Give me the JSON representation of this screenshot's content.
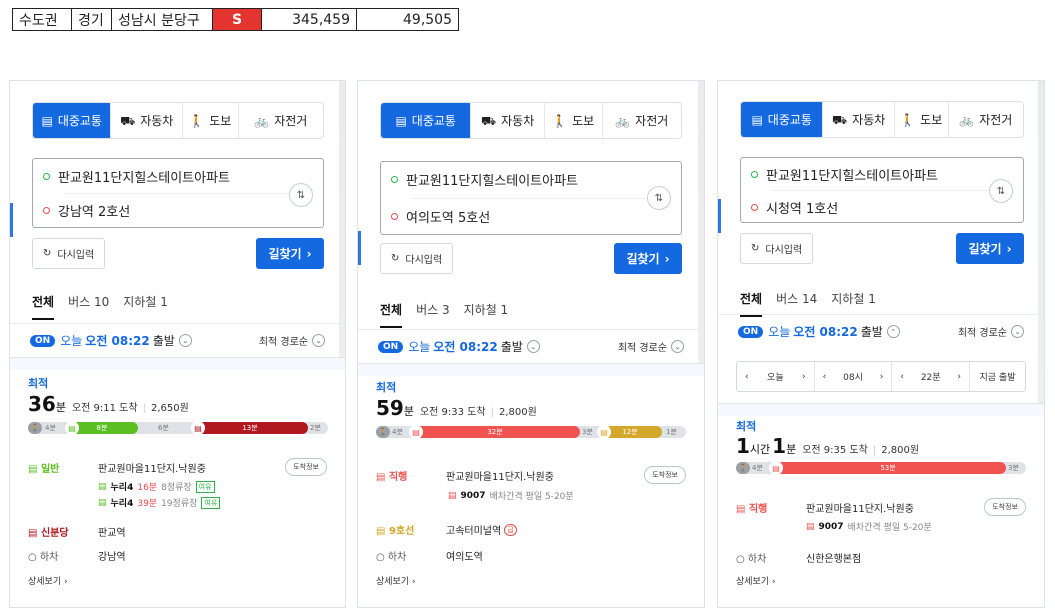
{
  "top_table": {
    "region": "수도권",
    "province": "경기",
    "city": "성남시 분당구",
    "grade": "S",
    "value1": "345,459",
    "value2": "49,505"
  },
  "mode_tabs": [
    "대중교통",
    "자동차",
    "도보",
    "자전거"
  ],
  "common": {
    "origin": "판교원11단지힐스테이트아파트",
    "reset_label": "다시입력",
    "find_label": "길찾기",
    "tab_all": "전체",
    "today": "오늘",
    "depart_time": "오전 08:22",
    "depart_suffix": "출발",
    "sort_label": "최적 경로순",
    "best_label": "최적",
    "arrive_info": "도착정보",
    "detail_link": "상세보기",
    "on_badge": "ON"
  },
  "panels": [
    {
      "destination": "강남역 2호선",
      "tab_bus": "버스 10",
      "tab_subway": "지하철 1",
      "summary": {
        "big": "36",
        "unit": "분",
        "arrive": "오전 9:11 도착",
        "fare": "2,650원"
      },
      "timeline": {
        "walk1": "4분",
        "seg1": "8분",
        "walk2": "6분",
        "seg2": "13분",
        "walk3": "2분"
      },
      "steps": [
        {
          "tag": "일반",
          "place": "판교원마을11단지.낙원중"
        },
        {
          "tag": "신분당",
          "place": "판교역"
        },
        {
          "tag": "하차",
          "place": "강남역"
        }
      ],
      "buses": [
        {
          "no": "누리4",
          "time": "16분",
          "stops": "8정류장",
          "status": "여유"
        },
        {
          "no": "누리4",
          "time": "39분",
          "stops": "19정류장",
          "status": "여유"
        }
      ]
    },
    {
      "destination": "여의도역 5호선",
      "tab_bus": "버스 3",
      "tab_subway": "지하철 1",
      "summary": {
        "big": "59",
        "unit": "분",
        "arrive": "오전 9:33 도착",
        "fare": "2,800원"
      },
      "timeline": {
        "walk1": "4분",
        "seg1": "32분",
        "walk2": "3분",
        "seg2": "12분",
        "walk3": "1분"
      },
      "steps": [
        {
          "tag": "직행",
          "place": "판교원마을11단지.낙원중"
        },
        {
          "tag": "9호선",
          "place": "고속터미널역"
        },
        {
          "tag": "하차",
          "place": "여의도역"
        }
      ],
      "bus": {
        "no": "9007",
        "interval": "배차간격 평일 5-20분"
      },
      "express_badge": "급"
    },
    {
      "destination": "시청역 1호선",
      "tab_bus": "버스 14",
      "tab_subway": "지하철 1",
      "summary": {
        "big1": "1",
        "unit1": "시간",
        "big2": "1",
        "unit2": "분",
        "arrive": "오전 9:35 도착",
        "fare": "2,800원"
      },
      "timeline": {
        "walk1": "4분",
        "seg1": "53분",
        "walk3": "3분"
      },
      "time_picker": {
        "day": "오늘",
        "hour": "08시",
        "minute": "22분",
        "now": "지금 출발"
      },
      "steps": [
        {
          "tag": "직행",
          "place": "판교원마을11단지.낙원중"
        },
        {
          "tag": "하차",
          "place": "신한은행본점"
        }
      ],
      "bus": {
        "no": "9007",
        "interval": "배차간격 평일 5-20분"
      }
    }
  ],
  "colors": {
    "accent": "#1569e0",
    "green_bus": "#5bbf21",
    "shinbundang": "#b1181f",
    "red_bus": "#f0524f",
    "line9": "#d4a729"
  }
}
